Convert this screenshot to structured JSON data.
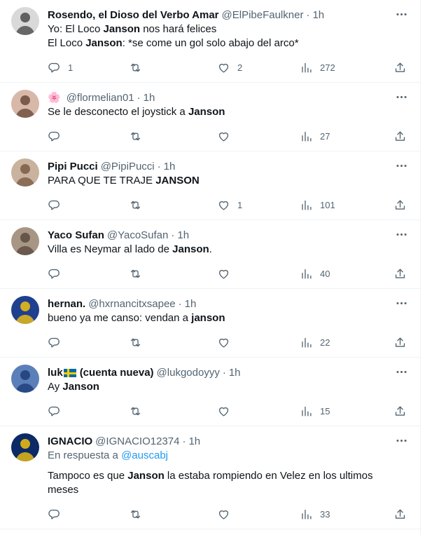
{
  "tweets": [
    {
      "name": "Rosendo, el Dioso del Verbo Amar",
      "handle": "@ElPibeFaulkner",
      "time": "1h",
      "lines": [
        [
          {
            "t": "Yo: El Loco "
          },
          {
            "t": "Janson",
            "b": true
          },
          {
            "t": " nos hará felices"
          }
        ],
        [
          {
            "t": "El Loco "
          },
          {
            "t": "Janson",
            "b": true
          },
          {
            "t": ": *se come un gol solo abajo del arco*"
          }
        ]
      ],
      "replies": "1",
      "retweets": "",
      "likes": "2",
      "views": "272",
      "avatar_colors": [
        "#d9d9d9",
        "#4a4a4a"
      ]
    },
    {
      "name": "",
      "name_emoji": "🌸",
      "handle": "@flormelian01",
      "time": "1h",
      "lines": [
        [
          {
            "t": "Se le desconecto el joystick a "
          },
          {
            "t": "Janson",
            "b": true
          }
        ]
      ],
      "replies": "",
      "retweets": "",
      "likes": "",
      "views": "27",
      "avatar_colors": [
        "#d8b8a8",
        "#6b4a3c"
      ]
    },
    {
      "name": "Pipi Pucci",
      "handle": "@PipiPucci",
      "time": "1h",
      "lines": [
        [
          {
            "t": "PARA QUE TE TRAJE "
          },
          {
            "t": "JANSON",
            "b": true
          }
        ]
      ],
      "replies": "",
      "retweets": "",
      "likes": "1",
      "views": "101",
      "avatar_colors": [
        "#c9b39e",
        "#7a5c46"
      ]
    },
    {
      "name": "Yaco Sufan",
      "handle": "@YacoSufan",
      "time": "1h",
      "lines": [
        [
          {
            "t": "Villa es Neymar al lado de "
          },
          {
            "t": "Janson",
            "b": true
          },
          {
            "t": "."
          }
        ]
      ],
      "replies": "",
      "retweets": "",
      "likes": "",
      "views": "40",
      "avatar_colors": [
        "#a89684",
        "#5a4a3e"
      ]
    },
    {
      "name": "hernan.",
      "handle": "@hxrnancitxsapee",
      "time": "1h",
      "lines": [
        [
          {
            "t": "bueno ya me canso: vendan a "
          },
          {
            "t": "janson",
            "b": true
          }
        ]
      ],
      "replies": "",
      "retweets": "",
      "likes": "",
      "views": "22",
      "avatar_colors": [
        "#1f3f8f",
        "#f2c20f"
      ]
    },
    {
      "name": "luk",
      "name_suffix": "(cuenta nueva)",
      "has_flag": true,
      "handle": "@lukgodoyyy",
      "time": "1h",
      "lines": [
        [
          {
            "t": "Ay "
          },
          {
            "t": "Janson",
            "b": true
          }
        ]
      ],
      "replies": "",
      "retweets": "",
      "likes": "",
      "views": "15",
      "avatar_colors": [
        "#5b7fb8",
        "#1e3d7a"
      ]
    },
    {
      "name": "IGNACIO",
      "handle": "@IGNACIO12374",
      "time": "1h",
      "reply_prefix": "En respuesta a",
      "reply_mention": "@auscabj",
      "lines": [
        [
          {
            "t": "Tampoco es que "
          },
          {
            "t": "Janson",
            "b": true
          },
          {
            "t": " la estaba rompiendo en Velez en los ultimos"
          }
        ],
        [
          {
            "t": "meses"
          }
        ]
      ],
      "replies": "",
      "retweets": "",
      "likes": "",
      "views": "33",
      "avatar_colors": [
        "#0b2a66",
        "#f2c20f"
      ]
    }
  ],
  "separator": "·",
  "icons": {
    "more": "more-icon",
    "reply": "reply-icon",
    "retweet": "retweet-icon",
    "like": "like-icon",
    "views": "views-icon",
    "share": "share-icon"
  }
}
